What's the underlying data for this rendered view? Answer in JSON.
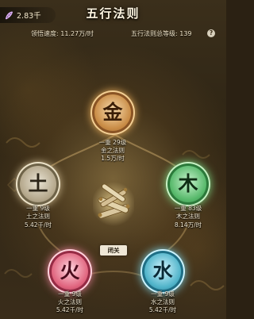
{
  "header": {
    "currency_value": "2.83千",
    "title": "五行法则",
    "comprehension_label": "领悟速度: 11.27万/时",
    "total_level_label": "五行法则总等级: 139",
    "help": "?"
  },
  "laws": {
    "metal": {
      "char": "金",
      "tier_level": "一重  29级",
      "name": "金之法则",
      "rate": "1.5万/时"
    },
    "earth": {
      "char": "土",
      "tier_level": "一重  9级",
      "name": "土之法则",
      "rate": "5.42千/时"
    },
    "wood": {
      "char": "木",
      "tier_level": "一重  83级",
      "name": "木之法则",
      "rate": "8.14万/时"
    },
    "fire": {
      "char": "火",
      "tier_level": "一重  9级",
      "name": "火之法则",
      "rate": "5.42千/时"
    },
    "water": {
      "char": "水",
      "tier_level": "一重  9级",
      "name": "水之法则",
      "rate": "5.42千/时"
    }
  },
  "breakthrough_label": "闭关",
  "colors": {
    "metal": "#d79a4a",
    "earth": "#b9ad95",
    "wood": "#55b86a",
    "fire": "#e0637c",
    "water": "#4fb3c9"
  }
}
